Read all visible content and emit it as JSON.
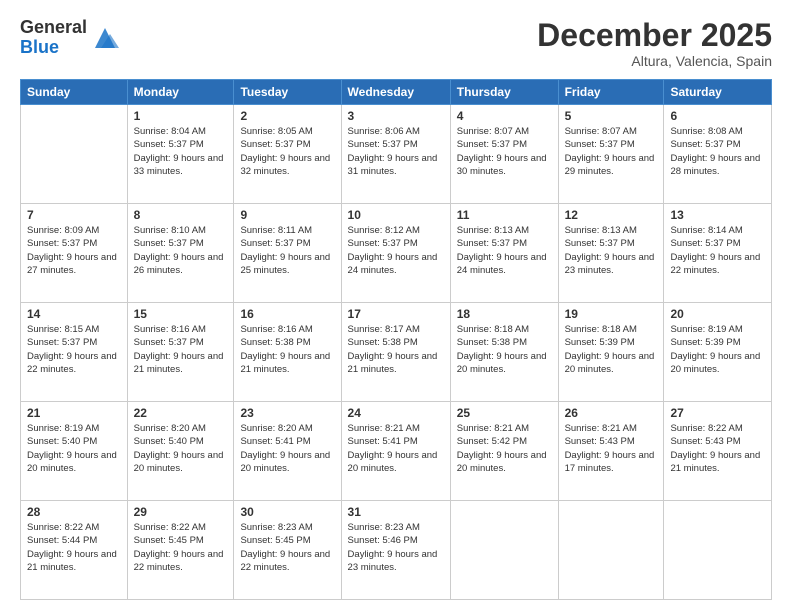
{
  "logo": {
    "general": "General",
    "blue": "Blue"
  },
  "header": {
    "month": "December 2025",
    "location": "Altura, Valencia, Spain"
  },
  "days_of_week": [
    "Sunday",
    "Monday",
    "Tuesday",
    "Wednesday",
    "Thursday",
    "Friday",
    "Saturday"
  ],
  "weeks": [
    [
      {
        "day": "",
        "sunrise": "",
        "sunset": "",
        "daylight": ""
      },
      {
        "day": "1",
        "sunrise": "Sunrise: 8:04 AM",
        "sunset": "Sunset: 5:37 PM",
        "daylight": "Daylight: 9 hours and 33 minutes."
      },
      {
        "day": "2",
        "sunrise": "Sunrise: 8:05 AM",
        "sunset": "Sunset: 5:37 PM",
        "daylight": "Daylight: 9 hours and 32 minutes."
      },
      {
        "day": "3",
        "sunrise": "Sunrise: 8:06 AM",
        "sunset": "Sunset: 5:37 PM",
        "daylight": "Daylight: 9 hours and 31 minutes."
      },
      {
        "day": "4",
        "sunrise": "Sunrise: 8:07 AM",
        "sunset": "Sunset: 5:37 PM",
        "daylight": "Daylight: 9 hours and 30 minutes."
      },
      {
        "day": "5",
        "sunrise": "Sunrise: 8:07 AM",
        "sunset": "Sunset: 5:37 PM",
        "daylight": "Daylight: 9 hours and 29 minutes."
      },
      {
        "day": "6",
        "sunrise": "Sunrise: 8:08 AM",
        "sunset": "Sunset: 5:37 PM",
        "daylight": "Daylight: 9 hours and 28 minutes."
      }
    ],
    [
      {
        "day": "7",
        "sunrise": "Sunrise: 8:09 AM",
        "sunset": "Sunset: 5:37 PM",
        "daylight": "Daylight: 9 hours and 27 minutes."
      },
      {
        "day": "8",
        "sunrise": "Sunrise: 8:10 AM",
        "sunset": "Sunset: 5:37 PM",
        "daylight": "Daylight: 9 hours and 26 minutes."
      },
      {
        "day": "9",
        "sunrise": "Sunrise: 8:11 AM",
        "sunset": "Sunset: 5:37 PM",
        "daylight": "Daylight: 9 hours and 25 minutes."
      },
      {
        "day": "10",
        "sunrise": "Sunrise: 8:12 AM",
        "sunset": "Sunset: 5:37 PM",
        "daylight": "Daylight: 9 hours and 24 minutes."
      },
      {
        "day": "11",
        "sunrise": "Sunrise: 8:13 AM",
        "sunset": "Sunset: 5:37 PM",
        "daylight": "Daylight: 9 hours and 24 minutes."
      },
      {
        "day": "12",
        "sunrise": "Sunrise: 8:13 AM",
        "sunset": "Sunset: 5:37 PM",
        "daylight": "Daylight: 9 hours and 23 minutes."
      },
      {
        "day": "13",
        "sunrise": "Sunrise: 8:14 AM",
        "sunset": "Sunset: 5:37 PM",
        "daylight": "Daylight: 9 hours and 22 minutes."
      }
    ],
    [
      {
        "day": "14",
        "sunrise": "Sunrise: 8:15 AM",
        "sunset": "Sunset: 5:37 PM",
        "daylight": "Daylight: 9 hours and 22 minutes."
      },
      {
        "day": "15",
        "sunrise": "Sunrise: 8:16 AM",
        "sunset": "Sunset: 5:37 PM",
        "daylight": "Daylight: 9 hours and 21 minutes."
      },
      {
        "day": "16",
        "sunrise": "Sunrise: 8:16 AM",
        "sunset": "Sunset: 5:38 PM",
        "daylight": "Daylight: 9 hours and 21 minutes."
      },
      {
        "day": "17",
        "sunrise": "Sunrise: 8:17 AM",
        "sunset": "Sunset: 5:38 PM",
        "daylight": "Daylight: 9 hours and 21 minutes."
      },
      {
        "day": "18",
        "sunrise": "Sunrise: 8:18 AM",
        "sunset": "Sunset: 5:38 PM",
        "daylight": "Daylight: 9 hours and 20 minutes."
      },
      {
        "day": "19",
        "sunrise": "Sunrise: 8:18 AM",
        "sunset": "Sunset: 5:39 PM",
        "daylight": "Daylight: 9 hours and 20 minutes."
      },
      {
        "day": "20",
        "sunrise": "Sunrise: 8:19 AM",
        "sunset": "Sunset: 5:39 PM",
        "daylight": "Daylight: 9 hours and 20 minutes."
      }
    ],
    [
      {
        "day": "21",
        "sunrise": "Sunrise: 8:19 AM",
        "sunset": "Sunset: 5:40 PM",
        "daylight": "Daylight: 9 hours and 20 minutes."
      },
      {
        "day": "22",
        "sunrise": "Sunrise: 8:20 AM",
        "sunset": "Sunset: 5:40 PM",
        "daylight": "Daylight: 9 hours and 20 minutes."
      },
      {
        "day": "23",
        "sunrise": "Sunrise: 8:20 AM",
        "sunset": "Sunset: 5:41 PM",
        "daylight": "Daylight: 9 hours and 20 minutes."
      },
      {
        "day": "24",
        "sunrise": "Sunrise: 8:21 AM",
        "sunset": "Sunset: 5:41 PM",
        "daylight": "Daylight: 9 hours and 20 minutes."
      },
      {
        "day": "25",
        "sunrise": "Sunrise: 8:21 AM",
        "sunset": "Sunset: 5:42 PM",
        "daylight": "Daylight: 9 hours and 20 minutes."
      },
      {
        "day": "26",
        "sunrise": "Sunrise: 8:21 AM",
        "sunset": "Sunset: 5:43 PM",
        "daylight": "Daylight: 9 hours and 17 minutes."
      },
      {
        "day": "27",
        "sunrise": "Sunrise: 8:22 AM",
        "sunset": "Sunset: 5:43 PM",
        "daylight": "Daylight: 9 hours and 21 minutes."
      }
    ],
    [
      {
        "day": "28",
        "sunrise": "Sunrise: 8:22 AM",
        "sunset": "Sunset: 5:44 PM",
        "daylight": "Daylight: 9 hours and 21 minutes."
      },
      {
        "day": "29",
        "sunrise": "Sunrise: 8:22 AM",
        "sunset": "Sunset: 5:45 PM",
        "daylight": "Daylight: 9 hours and 22 minutes."
      },
      {
        "day": "30",
        "sunrise": "Sunrise: 8:23 AM",
        "sunset": "Sunset: 5:45 PM",
        "daylight": "Daylight: 9 hours and 22 minutes."
      },
      {
        "day": "31",
        "sunrise": "Sunrise: 8:23 AM",
        "sunset": "Sunset: 5:46 PM",
        "daylight": "Daylight: 9 hours and 23 minutes."
      },
      {
        "day": "",
        "sunrise": "",
        "sunset": "",
        "daylight": ""
      },
      {
        "day": "",
        "sunrise": "",
        "sunset": "",
        "daylight": ""
      },
      {
        "day": "",
        "sunrise": "",
        "sunset": "",
        "daylight": ""
      }
    ]
  ]
}
